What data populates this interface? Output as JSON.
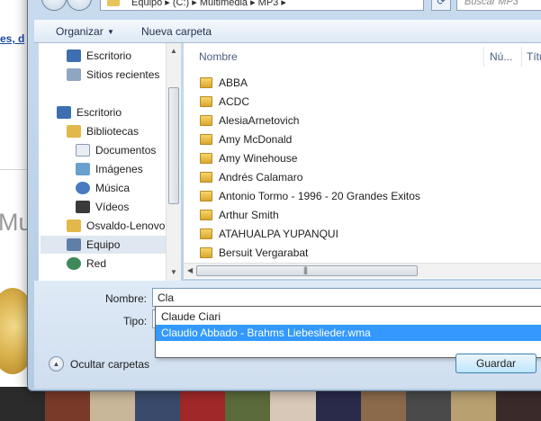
{
  "background": {
    "link_text": "es, d",
    "side_text": "Mus"
  },
  "address_bar": {
    "path": "Equipo  ▸  (C:)  ▸  Multimedia  ▸  MP3  ▸",
    "search_placeholder": "Buscar MP3"
  },
  "toolbar": {
    "organize_label": "Organizar",
    "new_folder_label": "Nueva carpeta"
  },
  "nav_pane": {
    "items": [
      {
        "label": "Escritorio",
        "icon": "desktop-icon"
      },
      {
        "label": "Sitios recientes",
        "icon": "recent-places-icon"
      },
      {
        "label": "Escritorio",
        "icon": "desktop-icon"
      },
      {
        "label": "Bibliotecas",
        "icon": "libraries-icon"
      },
      {
        "label": "Documentos",
        "icon": "documents-icon"
      },
      {
        "label": "Imágenes",
        "icon": "pictures-icon"
      },
      {
        "label": "Música",
        "icon": "music-icon"
      },
      {
        "label": "Vídeos",
        "icon": "videos-icon"
      },
      {
        "label": "Osvaldo-Lenovo",
        "icon": "user-folder-icon"
      },
      {
        "label": "Equipo",
        "icon": "computer-icon",
        "selected": true
      },
      {
        "label": "Red",
        "icon": "network-icon"
      }
    ]
  },
  "file_list": {
    "columns": [
      "Nombre",
      "Nú...",
      "Títu"
    ],
    "folders": [
      "ABBA",
      "ACDC",
      "AlesiaArnetovich",
      "Amy McDonald",
      "Amy Winehouse",
      "Andrés Calamaro",
      "Antonio Tormo - 1996 - 20 Grandes Exitos",
      "Arthur Smith",
      "ATAHUALPA YUPANQUI",
      "Bersuit Vergarabat"
    ]
  },
  "form": {
    "name_label": "Nombre:",
    "name_value": "Cla",
    "type_label": "Tipo:",
    "suggestions": [
      "Claude Ciari",
      "Claudio Abbado - Brahms Liebeslieder.wma"
    ],
    "selected_suggestion": 1
  },
  "footer": {
    "hide_folders_label": "Ocultar carpetas",
    "save_label": "Guardar"
  },
  "colors": {
    "selection": "#3399ff",
    "frame": "#b4cbe3",
    "link": "#1a4aa0"
  }
}
